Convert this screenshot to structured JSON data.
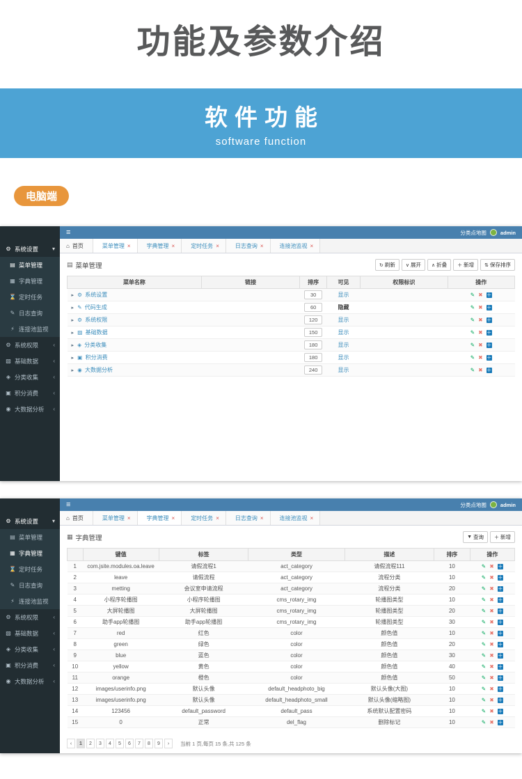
{
  "hero": {
    "title": "功能及参数介绍",
    "banner_title": "软件功能",
    "banner_subtitle": "software function",
    "badge": "电脑端",
    "colors": {
      "title": "#58595a",
      "banner_bg": "#4da3d4",
      "badge_bg": "#e8963c"
    }
  },
  "common": {
    "burger": "≡",
    "brand": "分类点地图",
    "username": "admin",
    "caret": "▸",
    "op_edit": "✎",
    "op_del": "✖",
    "op_add": "＋",
    "colors": {
      "topbar": "#4880ae",
      "sidebar": "#222d32",
      "accent": "#3c8dbc",
      "op_edit": "#00a65a",
      "op_del": "#e57368",
      "op_add": "#1a7bb9"
    }
  },
  "screen1": {
    "sidebar": [
      {
        "cls": "open",
        "icon": "⚙",
        "label": "系统设置",
        "caret": "▾"
      },
      {
        "cls": "sub active",
        "icon": "▤",
        "label": "菜单管理",
        "caret": ""
      },
      {
        "cls": "sub",
        "icon": "▦",
        "label": "字典管理",
        "caret": ""
      },
      {
        "cls": "sub",
        "icon": "⌛",
        "label": "定时任务",
        "caret": ""
      },
      {
        "cls": "sub",
        "icon": "✎",
        "label": "日志查询",
        "caret": ""
      },
      {
        "cls": "sub",
        "icon": "⚡",
        "label": "连接池监视",
        "caret": ""
      },
      {
        "cls": "sec",
        "icon": "⚙",
        "label": "系统权限",
        "caret": "‹"
      },
      {
        "cls": "sec",
        "icon": "▧",
        "label": "基础数据",
        "caret": "‹"
      },
      {
        "cls": "sec",
        "icon": "◈",
        "label": "分类收集",
        "caret": "‹"
      },
      {
        "cls": "sec",
        "icon": "▣",
        "label": "积分消费",
        "caret": "‹"
      },
      {
        "cls": "sec",
        "icon": "◉",
        "label": "大数据分析",
        "caret": "‹"
      }
    ],
    "tabs": [
      {
        "cls": "home",
        "icon": "⌂",
        "label": "首页",
        "close": ""
      },
      {
        "cls": "active",
        "icon": "",
        "label": "菜单管理",
        "close": "×"
      },
      {
        "cls": "",
        "icon": "",
        "label": "字典管理",
        "close": "×"
      },
      {
        "cls": "",
        "icon": "",
        "label": "定时任务",
        "close": "×"
      },
      {
        "cls": "",
        "icon": "",
        "label": "日志查询",
        "close": "×"
      },
      {
        "cls": "",
        "icon": "",
        "label": "连接池监视",
        "close": "×"
      }
    ],
    "panel": {
      "icon": "▤",
      "title": "菜单管理"
    },
    "toolbar": [
      {
        "icon": "↻",
        "label": "刷新"
      },
      {
        "icon": "∨",
        "label": "展开"
      },
      {
        "icon": "∧",
        "label": "折叠"
      },
      {
        "icon": "＋",
        "label": "新增"
      },
      {
        "icon": "⇅",
        "label": "保存排序"
      }
    ],
    "table": {
      "headers": [
        "菜单名称",
        "链接",
        "排序",
        "可见",
        "权限标识",
        "操作"
      ],
      "rows": [
        {
          "icon": "⚙",
          "name": "系统设置",
          "link": "",
          "sort": "30",
          "visible": "显示",
          "vis_cls": "",
          "perm": ""
        },
        {
          "icon": "✎",
          "name": "代码生成",
          "link": "",
          "sort": "60",
          "visible": "隐藏",
          "vis_cls": "hid",
          "perm": ""
        },
        {
          "icon": "⚙",
          "name": "系统权限",
          "link": "",
          "sort": "120",
          "visible": "显示",
          "vis_cls": "",
          "perm": ""
        },
        {
          "icon": "▨",
          "name": "基础数据",
          "link": "",
          "sort": "150",
          "visible": "显示",
          "vis_cls": "",
          "perm": ""
        },
        {
          "icon": "◈",
          "name": "分类收集",
          "link": "",
          "sort": "180",
          "visible": "显示",
          "vis_cls": "",
          "perm": ""
        },
        {
          "icon": "▣",
          "name": "积分消费",
          "link": "",
          "sort": "180",
          "visible": "显示",
          "vis_cls": "",
          "perm": ""
        },
        {
          "icon": "◉",
          "name": "大数据分析",
          "link": "",
          "sort": "240",
          "visible": "显示",
          "vis_cls": "",
          "perm": ""
        }
      ]
    }
  },
  "screen2": {
    "sidebar": [
      {
        "cls": "open",
        "icon": "⚙",
        "label": "系统设置",
        "caret": "▾"
      },
      {
        "cls": "sub",
        "icon": "▤",
        "label": "菜单管理",
        "caret": ""
      },
      {
        "cls": "sub active",
        "icon": "▦",
        "label": "字典管理",
        "caret": ""
      },
      {
        "cls": "sub",
        "icon": "⌛",
        "label": "定时任务",
        "caret": ""
      },
      {
        "cls": "sub",
        "icon": "✎",
        "label": "日志查询",
        "caret": ""
      },
      {
        "cls": "sub",
        "icon": "⚡",
        "label": "连接池监视",
        "caret": ""
      },
      {
        "cls": "sec",
        "icon": "⚙",
        "label": "系统权限",
        "caret": "‹"
      },
      {
        "cls": "sec",
        "icon": "▧",
        "label": "基础数据",
        "caret": "‹"
      },
      {
        "cls": "sec",
        "icon": "◈",
        "label": "分类收集",
        "caret": "‹"
      },
      {
        "cls": "sec",
        "icon": "▣",
        "label": "积分消费",
        "caret": "‹"
      },
      {
        "cls": "sec",
        "icon": "◉",
        "label": "大数据分析",
        "caret": "‹"
      }
    ],
    "tabs": [
      {
        "cls": "home",
        "icon": "⌂",
        "label": "首页",
        "close": ""
      },
      {
        "cls": "",
        "icon": "",
        "label": "菜单管理",
        "close": "×"
      },
      {
        "cls": "active",
        "icon": "",
        "label": "字典管理",
        "close": "×"
      },
      {
        "cls": "",
        "icon": "",
        "label": "定时任务",
        "close": "×"
      },
      {
        "cls": "",
        "icon": "",
        "label": "日志查询",
        "close": "×"
      },
      {
        "cls": "",
        "icon": "",
        "label": "连接池监视",
        "close": "×"
      }
    ],
    "panel": {
      "icon": "▦",
      "title": "字典管理"
    },
    "toolbar": [
      {
        "icon": "▼",
        "label": "查询"
      },
      {
        "icon": "＋",
        "label": "新增"
      }
    ],
    "table": {
      "headers": [
        "",
        "键值",
        "标签",
        "类型",
        "描述",
        "排序",
        "操作"
      ],
      "rows": [
        {
          "n": "1",
          "key": "com.jsite.modules.oa.leave",
          "label": "请假流程1",
          "type": "act_category",
          "desc": "请假流程111",
          "sort": "10"
        },
        {
          "n": "2",
          "key": "leave",
          "label": "请假流程",
          "type": "act_category",
          "desc": "流程分类",
          "sort": "10"
        },
        {
          "n": "3",
          "key": "metting",
          "label": "会议室申请流程",
          "type": "act_category",
          "desc": "流程分类",
          "sort": "20"
        },
        {
          "n": "4",
          "key": "小程序轮播图",
          "label": "小程序轮播图",
          "type": "cms_rotary_img",
          "desc": "轮播图类型",
          "sort": "10"
        },
        {
          "n": "5",
          "key": "大屏轮播图",
          "label": "大屏轮播图",
          "type": "cms_rotary_img",
          "desc": "轮播图类型",
          "sort": "20"
        },
        {
          "n": "6",
          "key": "助手app轮播图",
          "label": "助手app轮播图",
          "type": "cms_rotary_img",
          "desc": "轮播图类型",
          "sort": "30"
        },
        {
          "n": "7",
          "key": "red",
          "label": "红色",
          "type": "color",
          "desc": "颜色值",
          "sort": "10"
        },
        {
          "n": "8",
          "key": "green",
          "label": "绿色",
          "type": "color",
          "desc": "颜色值",
          "sort": "20"
        },
        {
          "n": "9",
          "key": "blue",
          "label": "蓝色",
          "type": "color",
          "desc": "颜色值",
          "sort": "30"
        },
        {
          "n": "10",
          "key": "yellow",
          "label": "黄色",
          "type": "color",
          "desc": "颜色值",
          "sort": "40"
        },
        {
          "n": "11",
          "key": "orange",
          "label": "橙色",
          "type": "color",
          "desc": "颜色值",
          "sort": "50"
        },
        {
          "n": "12",
          "key": "images/userinfo.png",
          "label": "默认头像",
          "type": "default_headphoto_big",
          "desc": "默认头像(大图)",
          "sort": "10"
        },
        {
          "n": "13",
          "key": "images/userinfo.png",
          "label": "默认头像",
          "type": "default_headphoto_small",
          "desc": "默认头像(缩略图)",
          "sort": "10"
        },
        {
          "n": "14",
          "key": "123456",
          "label": "default_password",
          "type": "default_pass",
          "desc": "系统默认配置密码",
          "sort": "10"
        },
        {
          "n": "15",
          "key": "0",
          "label": "正常",
          "type": "del_flag",
          "desc": "删除标记",
          "sort": "10"
        }
      ]
    },
    "pagination": {
      "prev": "‹",
      "pages": [
        {
          "label": "1",
          "cls": "cur"
        },
        {
          "label": "2",
          "cls": ""
        },
        {
          "label": "3",
          "cls": ""
        },
        {
          "label": "4",
          "cls": ""
        },
        {
          "label": "5",
          "cls": ""
        },
        {
          "label": "6",
          "cls": ""
        },
        {
          "label": "7",
          "cls": ""
        },
        {
          "label": "8",
          "cls": ""
        },
        {
          "label": "9",
          "cls": ""
        }
      ],
      "next": "›",
      "status": "当前 1 页,每页 15 条,共 125 条"
    }
  }
}
